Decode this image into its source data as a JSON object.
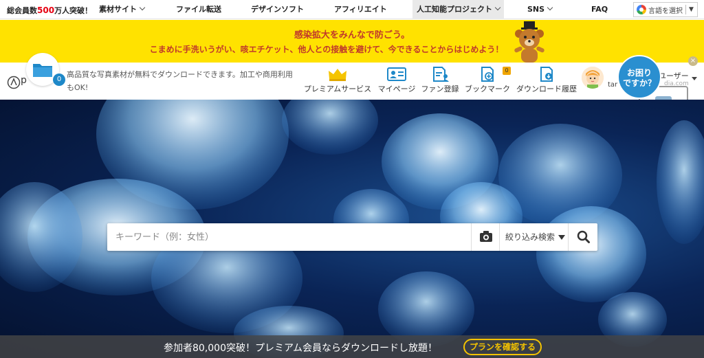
{
  "topnav": {
    "members_prefix": "総会員数",
    "members_count": "500",
    "members_suffix": "万人突破！",
    "items": [
      {
        "label": "素材サイト"
      },
      {
        "label": "ファイル転送"
      },
      {
        "label": "デザインソフト"
      },
      {
        "label": "アフィリエイト"
      },
      {
        "label": "人工知能プロジェクト"
      },
      {
        "label": "SNS"
      },
      {
        "label": "FAQ"
      }
    ],
    "language": "言語を選択"
  },
  "banner": {
    "title": "感染拡大をみんなで防ごう。",
    "message": "こまめに手洗いうがい、咳エチケット、他人との接触を避けて、今できることからはじめよう！"
  },
  "header": {
    "logo_text": "p",
    "folder_count": "0",
    "tagline": "高品質な写真素材が無料でダウンロードできます。加工や商用利用もOK!",
    "nav": [
      {
        "label": "プレミアムサービス",
        "icon": "crown-icon"
      },
      {
        "label": "マイページ",
        "icon": "id-card-icon"
      },
      {
        "label": "ファン登録",
        "icon": "fan-register-icon"
      },
      {
        "label": "ブックマーク",
        "icon": "bookmark-icon",
        "badge": "0"
      },
      {
        "label": "ダウンロード履歴",
        "icon": "download-history-icon"
      }
    ],
    "user_label": "ユーザー",
    "user_name": "tar",
    "user_email_fragment": "dia.com"
  },
  "help": {
    "line1": "お困り",
    "line2": "ですか？"
  },
  "search": {
    "placeholder": "キーワード（例：女性）",
    "filter_label": "絞り込み検索"
  },
  "promo": {
    "text": "参加者80,000突破！プレミアム会員ならダウンロードし放題！",
    "button": "プランを確認する"
  },
  "colors": {
    "banner": "#ffe200",
    "accent_red": "#e60012",
    "accent_blue": "#2a8fd0",
    "promo_button": "#f5c400"
  }
}
